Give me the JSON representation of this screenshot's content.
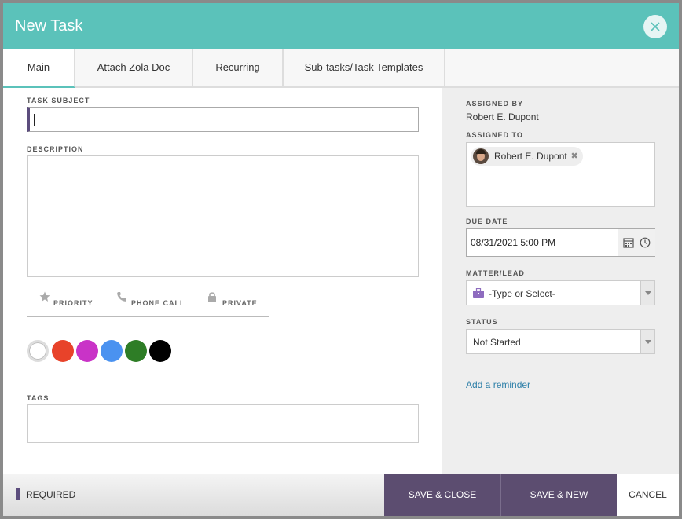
{
  "header": {
    "title": "New Task"
  },
  "tabs": [
    {
      "label": "Main"
    },
    {
      "label": "Attach Zola Doc"
    },
    {
      "label": "Recurring"
    },
    {
      "label": "Sub-tasks/Task Templates"
    }
  ],
  "form": {
    "task_subject_label": "TASK SUBJECT",
    "task_subject_value": "",
    "description_label": "DESCRIPTION",
    "description_value": "",
    "flags": [
      {
        "label": "PRIORITY",
        "icon": "star-icon"
      },
      {
        "label": "PHONE CALL",
        "icon": "phone-icon"
      },
      {
        "label": "PRIVATE",
        "icon": "lock-icon"
      }
    ],
    "colors": [
      "#ffffff",
      "#e8432a",
      "#c933c7",
      "#4a92f0",
      "#2e7d26",
      "#000000"
    ],
    "tags_label": "TAGS"
  },
  "sidebar": {
    "assigned_by_label": "ASSIGNED BY",
    "assigned_by_value": "Robert E. Dupont",
    "assigned_to_label": "ASSIGNED TO",
    "assigned_to_chip": "Robert E. Dupont",
    "due_date_label": "DUE DATE",
    "due_date_value": "08/31/2021 5:00 PM",
    "matter_label": "MATTER/LEAD",
    "matter_placeholder": "-Type or Select-",
    "status_label": "STATUS",
    "status_value": "Not Started",
    "reminder_link": "Add a reminder"
  },
  "footer": {
    "required_label": "REQUIRED",
    "save_close": "SAVE & CLOSE",
    "save_new": "SAVE & NEW",
    "cancel": "CANCEL"
  },
  "colors": {
    "header": "#5bc2ba",
    "primary_button": "#5c4d70",
    "link": "#2d7fa8"
  }
}
